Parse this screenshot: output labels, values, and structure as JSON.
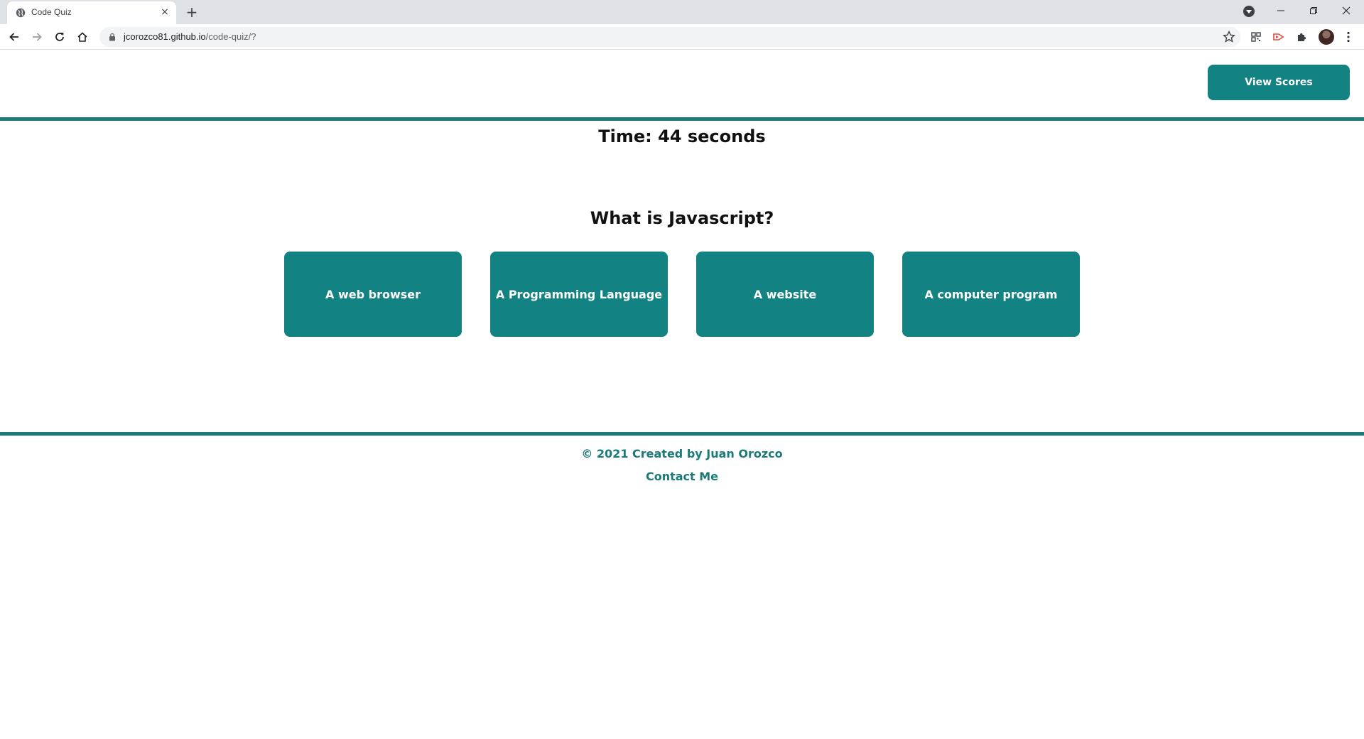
{
  "browser": {
    "tab_title": "Code Quiz",
    "tab_close_glyph": "×",
    "new_tab_glyph": "+",
    "url_host": "jcorozco81.github.io",
    "url_path": "/code-quiz/?"
  },
  "header": {
    "view_scores_label": "View Scores"
  },
  "quiz": {
    "timer_text": "Time: 44 seconds",
    "question": "What is Javascript?",
    "answers": [
      "A web browser",
      "A Programming Language",
      "A website",
      "A computer program"
    ]
  },
  "footer": {
    "credit": "© 2021 Created by Juan Orozco",
    "contact_label": "Contact Me"
  },
  "colors": {
    "accent": "#128282",
    "rule": "#1b7a78",
    "footer_text": "#1b7a78"
  }
}
